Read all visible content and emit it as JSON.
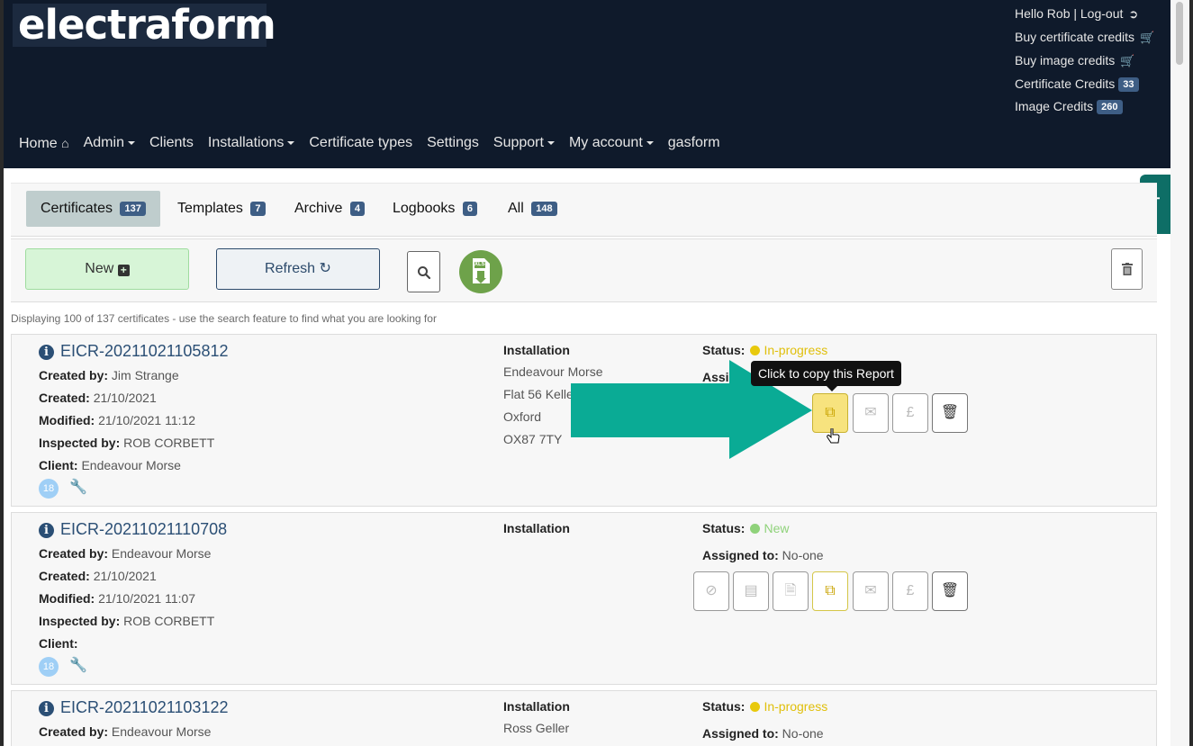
{
  "brand": {
    "logo_text": "electraform"
  },
  "account": {
    "greeting": "Hello Rob | Log-out",
    "buy_cert_credits": "Buy certificate credits",
    "buy_image_credits": "Buy image credits",
    "cert_credits_label": "Certificate Credits",
    "cert_credits_count": "33",
    "image_credits_label": "Image Credits",
    "image_credits_count": "260"
  },
  "nav": {
    "home": "Home",
    "admin": "Admin",
    "clients": "Clients",
    "installations": "Installations",
    "certificate_types": "Certificate types",
    "settings": "Settings",
    "support": "Support",
    "my_account": "My account",
    "gasform": "gasform"
  },
  "help": {
    "label": "Help!"
  },
  "tabs": [
    {
      "label": "Certificates",
      "count": "137",
      "active": true
    },
    {
      "label": "Templates",
      "count": "7"
    },
    {
      "label": "Archive",
      "count": "4"
    },
    {
      "label": "Logbooks",
      "count": "6"
    },
    {
      "label": "All",
      "count": "148"
    }
  ],
  "toolbar": {
    "new_label": "New",
    "refresh_label": "Refresh",
    "xls_label": "XLS"
  },
  "info_line": "Displaying 100 of 137 certificates - use the search feature to find what you are looking for",
  "labels": {
    "created_by": "Created by:",
    "created": "Created:",
    "modified": "Modified:",
    "inspected_by": "Inspected by:",
    "client": "Client:",
    "installation": "Installation",
    "status": "Status:",
    "assigned_to": "Assigned to:"
  },
  "tooltip": "Click to copy this Report",
  "certificates": [
    {
      "id": "EICR-20211021105812",
      "created_by": "Jim Strange",
      "created": "21/10/2021",
      "modified": "21/10/2021 11:12",
      "inspected_by": "ROB CORBETT",
      "client": "Endeavour Morse",
      "count": "18",
      "installation": [
        "Endeavour Morse",
        "Flat 56 Kelle",
        "Oxford",
        "OX87 7TY"
      ],
      "status": "In-progress",
      "assigned_visible": "Assig"
    },
    {
      "id": "EICR-20211021110708",
      "created_by": "Endeavour Morse",
      "created": "21/10/2021",
      "modified": "21/10/2021 11:07",
      "inspected_by": "ROB CORBETT",
      "client": "",
      "count": "18",
      "installation": [],
      "status": "New",
      "assigned_to": "No-one"
    },
    {
      "id": "EICR-20211021103122",
      "created_by": "Endeavour Morse",
      "installation": [
        "Ross Geller"
      ],
      "status": "In-progress",
      "assigned_to": "No-one"
    }
  ],
  "colors": {
    "header_bg": "#0f1a2b",
    "badge": "#3e5e85",
    "status_in_progress": "#e8c90c",
    "status_new": "#8fd27a",
    "arrow": "#0aab95",
    "help_tab": "#0e6e66"
  }
}
